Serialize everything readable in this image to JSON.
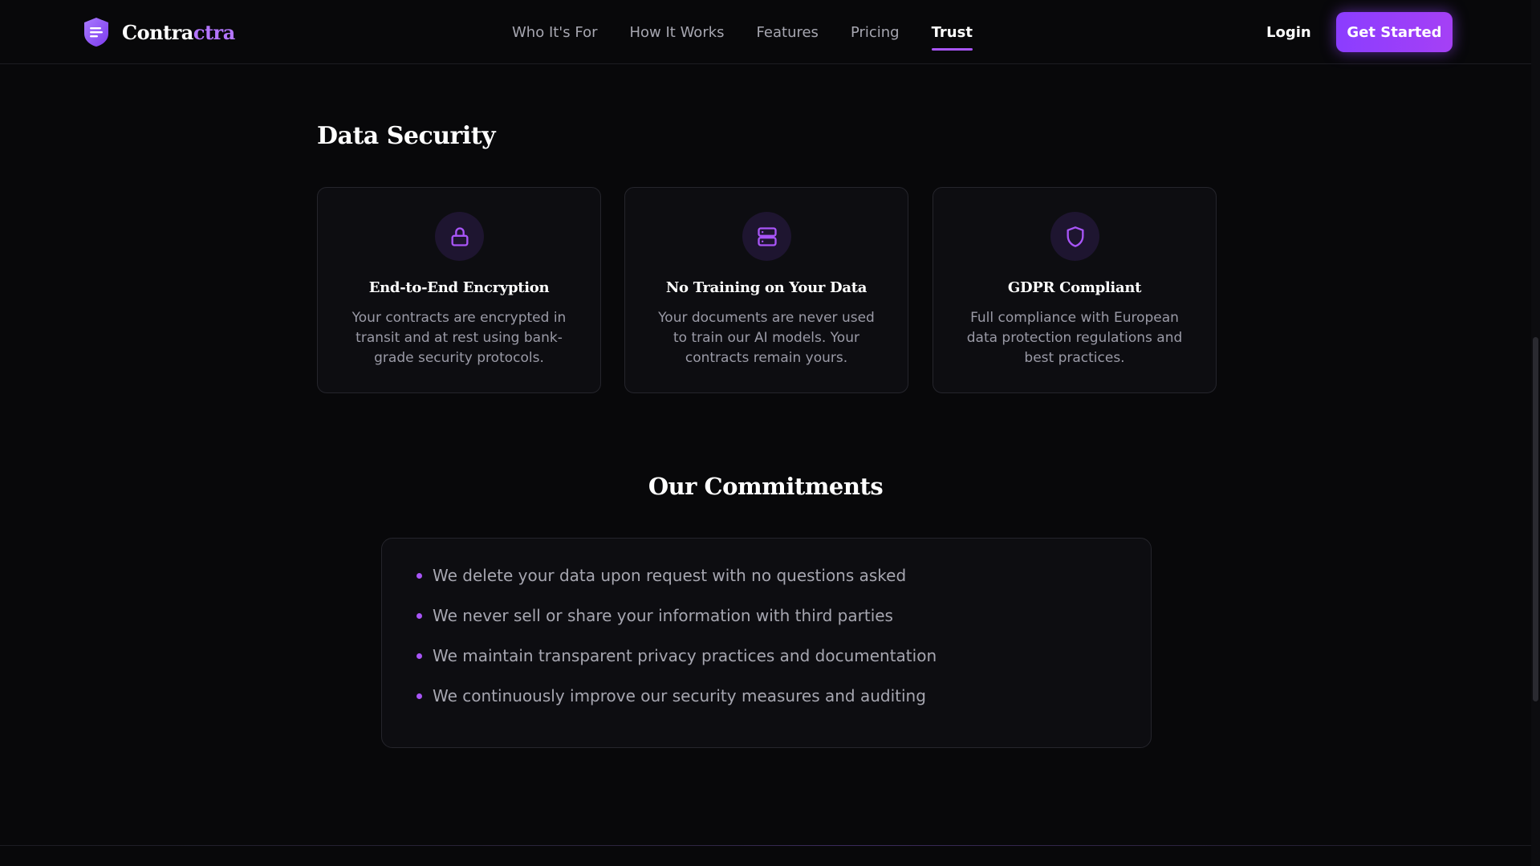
{
  "brand": {
    "name_part1": "Contra",
    "name_part2": "ctra",
    "accent": "#b476ff"
  },
  "nav": {
    "links": [
      {
        "label": "Who It's For",
        "active": false
      },
      {
        "label": "How It Works",
        "active": false
      },
      {
        "label": "Features",
        "active": false
      },
      {
        "label": "Pricing",
        "active": false
      },
      {
        "label": "Trust",
        "active": true
      }
    ],
    "login_label": "Login",
    "cta_label": "Get Started"
  },
  "security": {
    "title": "Data Security",
    "cards": [
      {
        "icon": "lock-icon",
        "title": "End-to-End Encryption",
        "description": "Your contracts are encrypted in transit and at rest using bank-grade security protocols."
      },
      {
        "icon": "server-icon",
        "title": "No Training on Your Data",
        "description": "Your documents are never used to train our AI models. Your contracts remain yours."
      },
      {
        "icon": "shield-icon",
        "title": "GDPR Compliant",
        "description": "Full compliance with European data protection regulations and best practices."
      }
    ]
  },
  "commitments": {
    "title": "Our Commitments",
    "items": [
      "We delete your data upon request with no questions asked",
      "We never sell or share your information with third parties",
      "We maintain transparent privacy practices and documentation",
      "We continuously improve our security measures and auditing"
    ]
  },
  "colors": {
    "accent": "#a855f7",
    "background": "#08080a",
    "card": "#0d0d11"
  }
}
